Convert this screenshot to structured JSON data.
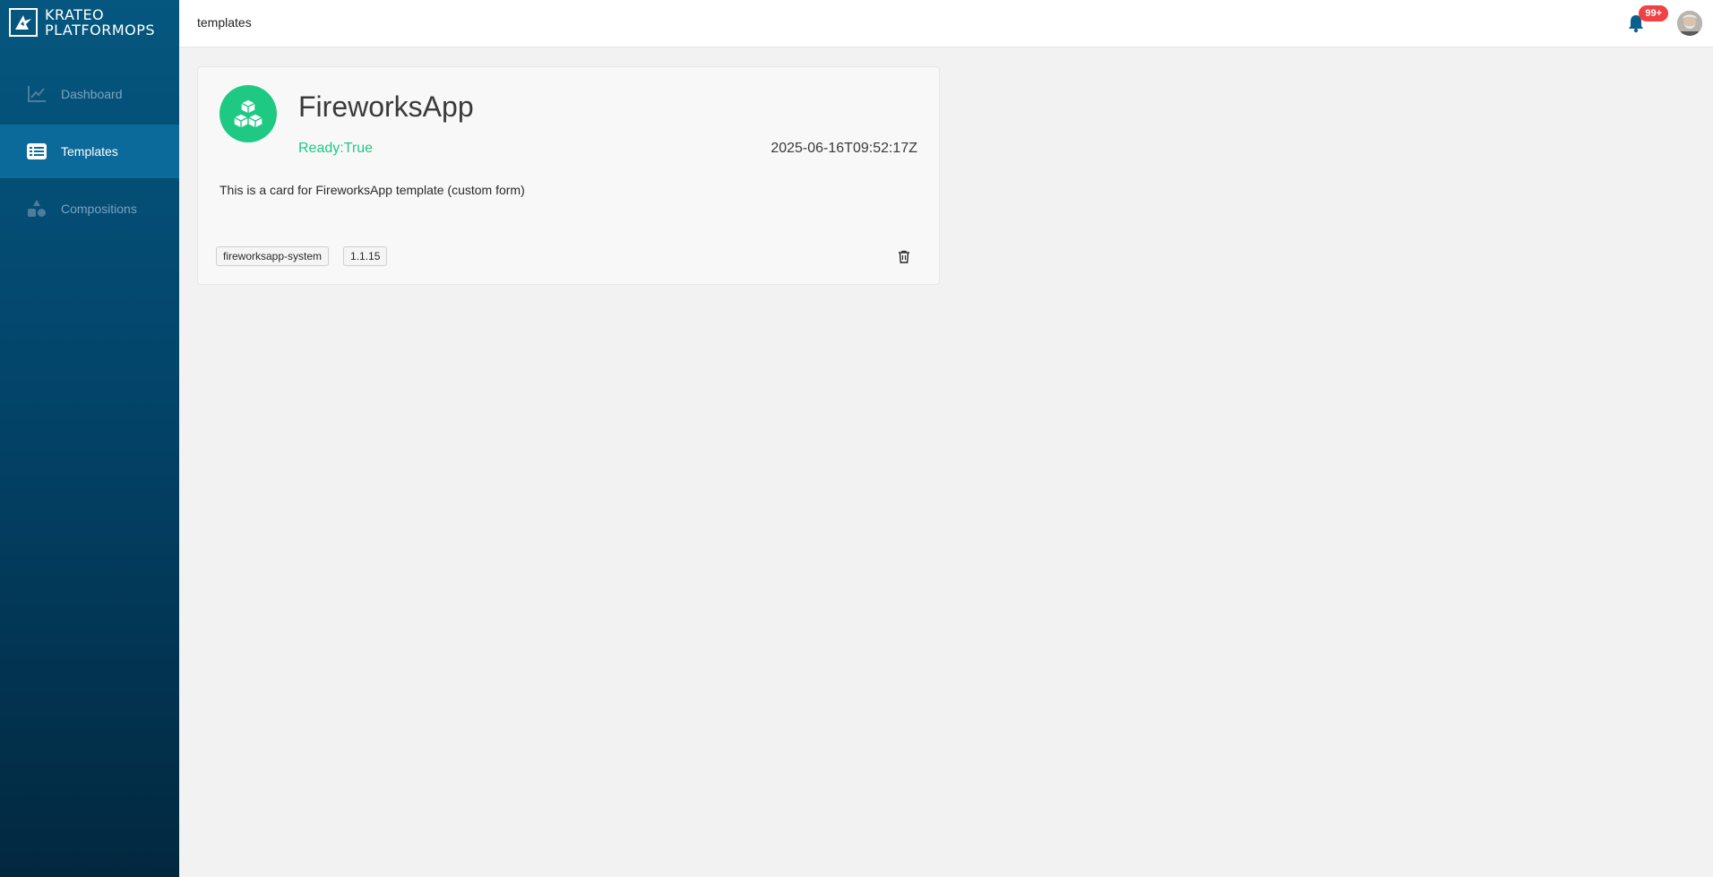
{
  "app": {
    "logo_line1": "KRATEO",
    "logo_line2": "PLATFORMOPS"
  },
  "sidebar": {
    "items": [
      {
        "label": "Dashboard",
        "icon": "chart-line-icon",
        "active": false
      },
      {
        "label": "Templates",
        "icon": "list-icon",
        "active": true
      },
      {
        "label": "Compositions",
        "icon": "shapes-icon",
        "active": false
      }
    ]
  },
  "header": {
    "breadcrumb": "templates",
    "notification_badge": "99+"
  },
  "card": {
    "title": "FireworksApp",
    "status": "Ready:True",
    "date": "2025-06-16T09:52:17Z",
    "description": "This is a card for FireworksApp template (custom form)",
    "tags": [
      "fireworksapp-system",
      "1.1.15"
    ],
    "icon": "cubes-icon"
  },
  "colors": {
    "sidebar_top": "#05577f",
    "sidebar_bottom": "#02283f",
    "active_item": "#0c6a9a",
    "accent_green": "#1ec983",
    "badge_red": "#f04245"
  }
}
